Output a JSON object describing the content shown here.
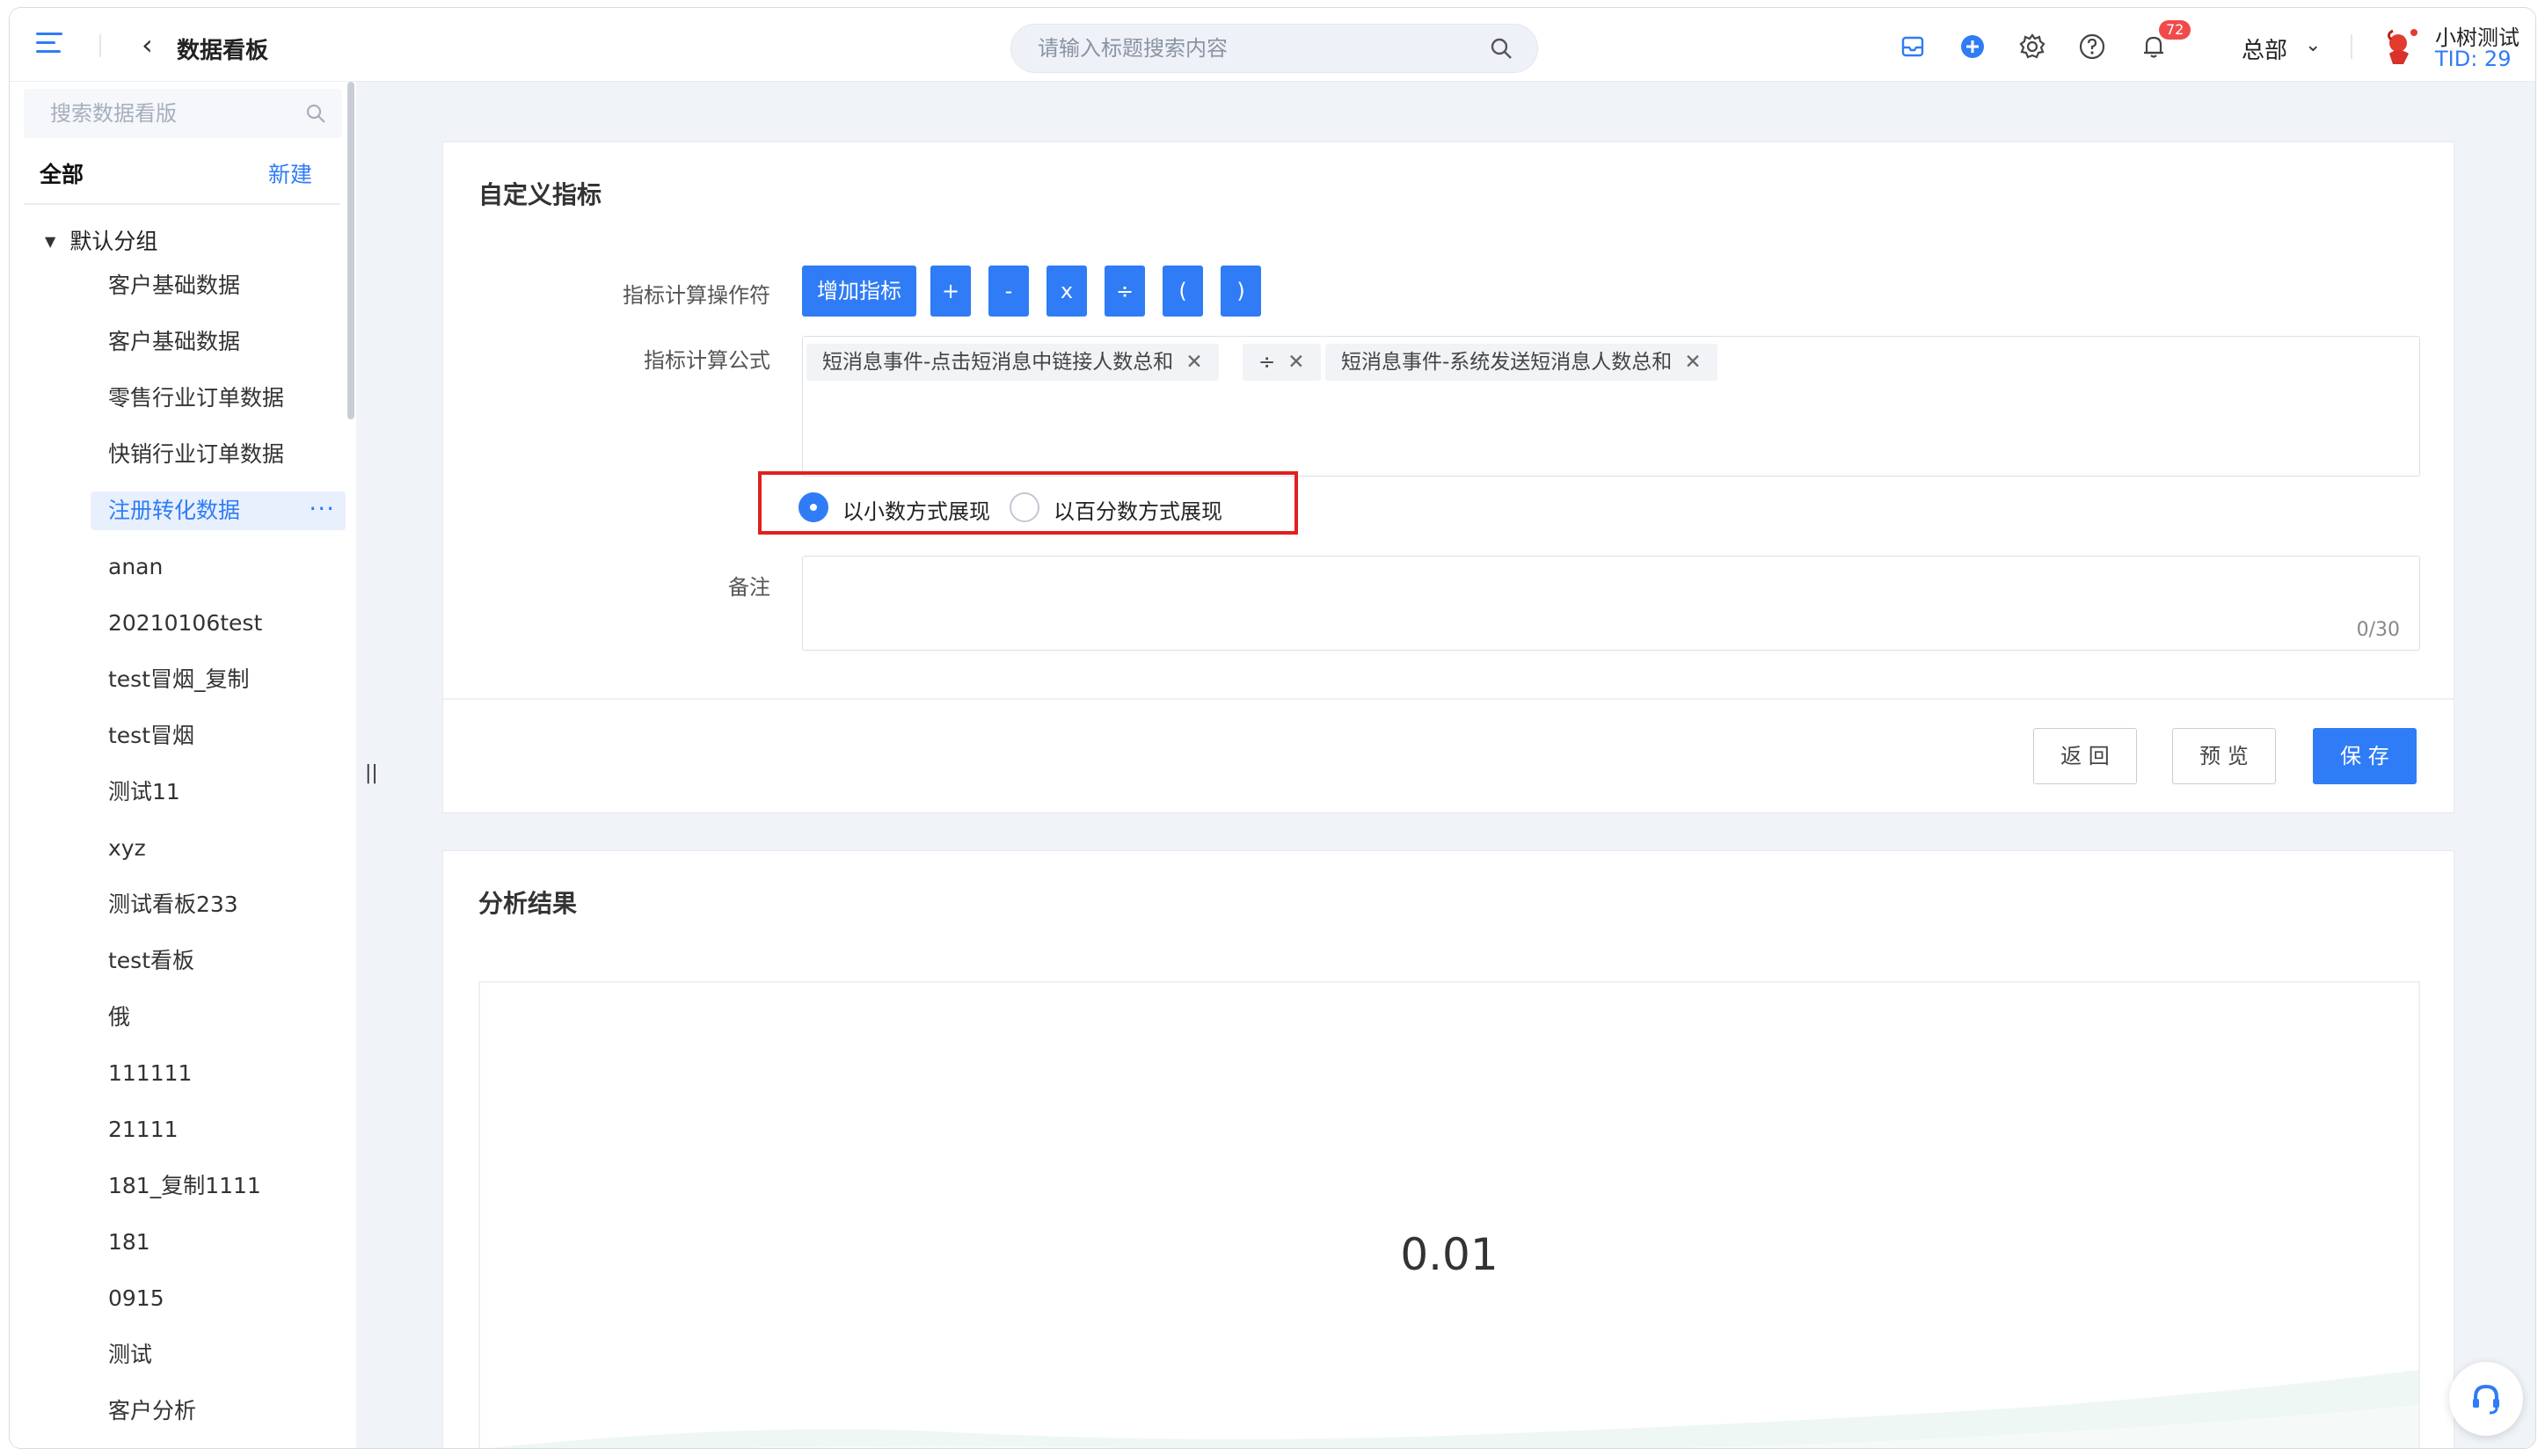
{
  "header": {
    "title": "数据看板",
    "search_placeholder": "请输入标题搜索内容",
    "notification_count": "72",
    "org": "总部",
    "user_name": "小树测试",
    "user_tid": "TID: 29",
    "icons": [
      "menu-icon",
      "back-icon",
      "search-icon",
      "inbox-icon",
      "add-icon",
      "gear-icon",
      "help-icon",
      "bell-icon",
      "chevron-down-icon",
      "avatar"
    ]
  },
  "sidebar": {
    "search_placeholder": "搜索数据看版",
    "all_label": "全部",
    "new_label": "新建",
    "group_label": "默认分组",
    "items": [
      {
        "label": "客户基础数据"
      },
      {
        "label": "客户基础数据"
      },
      {
        "label": "零售行业订单数据"
      },
      {
        "label": "快销行业订单数据"
      },
      {
        "label": "注册转化数据",
        "active": true
      },
      {
        "label": "anan"
      },
      {
        "label": "20210106test"
      },
      {
        "label": "test冒烟_复制"
      },
      {
        "label": "test冒烟"
      },
      {
        "label": "测试11"
      },
      {
        "label": "xyz"
      },
      {
        "label": "测试看板233"
      },
      {
        "label": "test看板"
      },
      {
        "label": "俄"
      },
      {
        "label": "111111"
      },
      {
        "label": "21111"
      },
      {
        "label": "181_复制1111"
      },
      {
        "label": "181"
      },
      {
        "label": "0915"
      },
      {
        "label": "测试"
      },
      {
        "label": "客户分析"
      }
    ],
    "more_label": "···"
  },
  "metric_card": {
    "title": "自定义指标",
    "operator_label": "指标计算操作符",
    "operators": [
      "增加指标",
      "+",
      "-",
      "x",
      "÷",
      "(",
      ")"
    ],
    "formula_label": "指标计算公式",
    "formula_tags": [
      "短消息事件-点击短消息中链接人数总和",
      "÷",
      "短消息事件-系统发送短消息人数总和"
    ],
    "display_options": [
      "以小数方式展现",
      "以百分数方式展现"
    ],
    "display_selected": "以小数方式展现",
    "remark_label": "备注",
    "remark_value": "",
    "remark_counter": "0/30",
    "buttons": {
      "back": "返 回",
      "preview": "预 览",
      "save": "保 存"
    }
  },
  "result_card": {
    "title": "分析结果",
    "value": "0.01"
  },
  "colors": {
    "accent": "#2f7cf6",
    "highlight_border": "#e0201f",
    "background": "#f0f3f7"
  }
}
